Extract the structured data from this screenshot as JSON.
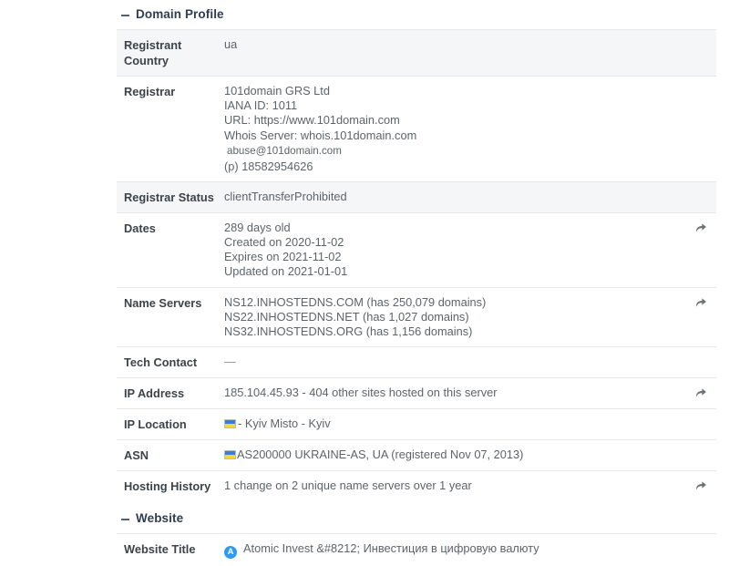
{
  "sections": [
    {
      "id": "domain-profile",
      "title": "Domain Profile",
      "toggle_icon": "minus-icon"
    },
    {
      "id": "website",
      "title": "Website",
      "toggle_icon": "minus-icon"
    }
  ],
  "domain_profile": {
    "registrant_country": {
      "label": "Registrant Country",
      "value": "ua"
    },
    "registrar": {
      "label": "Registrar",
      "name": "101domain GRS Ltd",
      "iana": "IANA ID: 1011",
      "url": "URL: https://www.101domain.com",
      "whois_server": "Whois Server: whois.101domain.com",
      "abuse_email": "abuse@101domain.com",
      "phone": "(p) 18582954626"
    },
    "registrar_status": {
      "label": "Registrar Status",
      "value": "clientTransferProhibited"
    },
    "dates": {
      "label": "Dates",
      "age": "289 days old",
      "created": "Created on 2020-11-02",
      "expires": "Expires on 2021-11-02",
      "updated": "Updated on 2021-01-01"
    },
    "name_servers": {
      "label": "Name Servers",
      "values": [
        "NS12.INHOSTEDNS.COM (has 250,079 domains)",
        "NS22.INHOSTEDNS.NET (has 1,027 domains)",
        "NS32.INHOSTEDNS.ORG (has 1,156 domains)"
      ]
    },
    "tech_contact": {
      "label": "Tech Contact",
      "value": "—"
    },
    "ip_address": {
      "label": "IP Address",
      "value": "185.104.45.93 - 404 other sites hosted on this server"
    },
    "ip_location": {
      "label": "IP Location",
      "flag_icon": "ukraine-flag-icon",
      "value": "- Kyiv Misto - Kyiv"
    },
    "asn": {
      "label": "ASN",
      "flag_icon": "ukraine-flag-icon",
      "value": "AS200000 UKRAINE-AS, UA (registered Nov 07, 2013)"
    },
    "hosting_history": {
      "label": "Hosting History",
      "value": "1 change on 2 unique name servers over 1 year"
    }
  },
  "website": {
    "website_title": {
      "label": "Website Title",
      "favicon_letter": "A",
      "favicon_icon": "site-favicon-icon",
      "value": "Atomic Invest &#8212; Инвестиция в цифровую валюту"
    }
  },
  "icons": {
    "share_arrow": "share-arrow-icon"
  },
  "colors": {
    "accent": "#2e9bef",
    "header_text": "#2f3d4f",
    "label_text": "#3c4349",
    "value_text": "#5d6469",
    "row_stripe": "#f5f6f7",
    "row_border": "#e7e9eb",
    "flag_blue": "#3b7fd4",
    "flag_yellow": "#f2d73f"
  }
}
